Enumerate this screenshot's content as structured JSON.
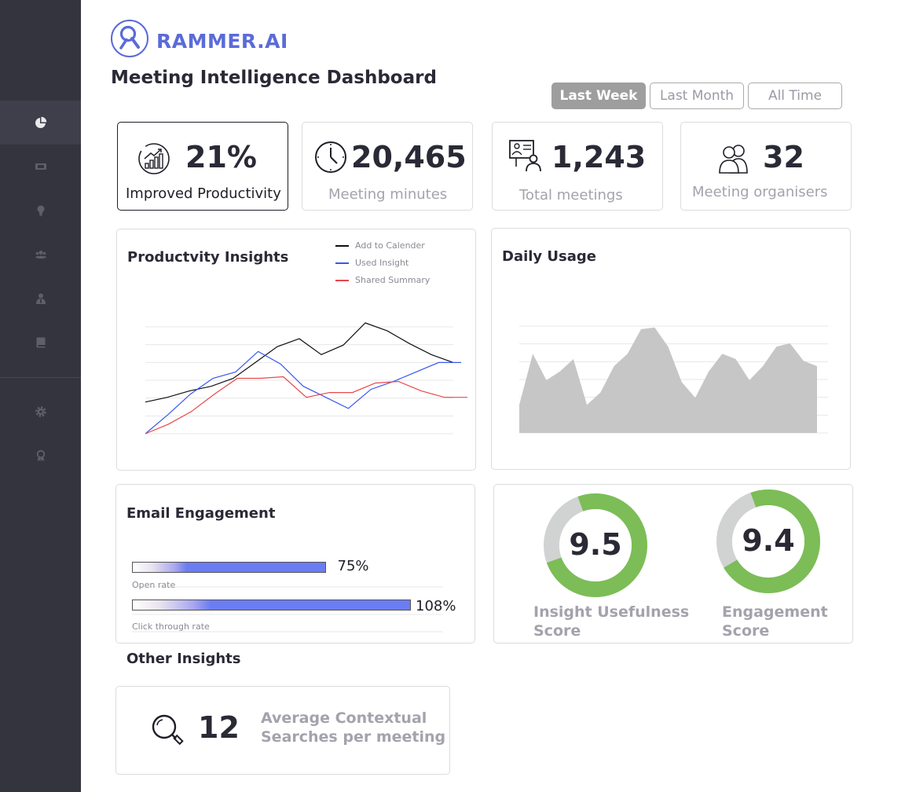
{
  "brand": {
    "name": "RAMMER.AI"
  },
  "page_title": "Meeting Intelligence Dashboard",
  "sidebar": {
    "items": [
      {
        "icon": "pie-chart-icon",
        "active": true
      },
      {
        "icon": "ticket-icon",
        "active": false
      },
      {
        "icon": "lightbulb-icon",
        "active": false
      },
      {
        "icon": "users-icon",
        "active": false
      },
      {
        "icon": "user-tie-icon",
        "active": false
      },
      {
        "icon": "book-icon",
        "active": false
      },
      {
        "icon": "gear-icon",
        "active": false
      },
      {
        "icon": "award-icon",
        "active": false
      }
    ]
  },
  "time_range": {
    "options": [
      "Last Week",
      "Last Month",
      "All Time"
    ],
    "selected": "Last Week"
  },
  "stats": [
    {
      "value": "21%",
      "label": "Improved Productivity",
      "icon": "growth-chart-icon",
      "selected": true
    },
    {
      "value": "20,465",
      "label": "Meeting minutes",
      "icon": "clock-icon",
      "selected": false
    },
    {
      "value": "1,243",
      "label": "Total meetings",
      "icon": "presentation-icon",
      "selected": false
    },
    {
      "value": "32",
      "label": "Meeting organisers",
      "icon": "people-icon",
      "selected": false
    }
  ],
  "productivity": {
    "title": "Productvity Insights",
    "legend": [
      "Add to Calender",
      "Used Insight",
      "Shared Summary"
    ]
  },
  "daily_usage": {
    "title": "Daily Usage"
  },
  "email": {
    "title": "Email Engagement",
    "bars": [
      {
        "label": "Open rate",
        "value_text": "75%",
        "value": 75
      },
      {
        "label": "Click through rate",
        "value_text": "108%",
        "value": 108
      }
    ]
  },
  "scores": [
    {
      "value_text": "9.5",
      "value": 9.5,
      "max": 10,
      "label_line1": "Insight Usefulness",
      "label_line2": "Score"
    },
    {
      "value_text": "9.4",
      "value": 9.4,
      "max": 10,
      "label_line1": "Engagement",
      "label_line2": "Score"
    }
  ],
  "other_insights": {
    "title": "Other Insights",
    "value": "12",
    "label_line1": "Average Contextual",
    "label_line2": "Searches per meeting",
    "icon": "search-icon"
  },
  "colors": {
    "accent": "#5b6bd8",
    "sidebar": "#34343f",
    "series_black": "#111111",
    "series_blue": "#3a57f0",
    "series_red": "#e8474b",
    "area_fill": "#c6c6c6",
    "donut_green": "#7cbd57",
    "donut_grey": "#d0d3d2"
  },
  "chart_data": [
    {
      "type": "line",
      "title": "Productvity Insights",
      "x": [
        1,
        2,
        3,
        4,
        5,
        6,
        7,
        8,
        9,
        10,
        11,
        12,
        13,
        14,
        15
      ],
      "series": [
        {
          "name": "Add to Calender",
          "values": [
            2,
            2.3,
            2.7,
            3,
            3.5,
            4.5,
            5.5,
            6,
            5,
            5.6,
            7,
            6.5,
            5.7,
            5,
            4.5
          ]
        },
        {
          "name": "Used Insight",
          "values": [
            0,
            1.2,
            2.5,
            3.5,
            3.9,
            5.2,
            4.4,
            3,
            2.3,
            1.6,
            2.8,
            3.3,
            3.9,
            4.5,
            4.5
          ]
        },
        {
          "name": "Shared Summary",
          "values": [
            0,
            0.6,
            1.4,
            2.5,
            3.5,
            3.5,
            3.6,
            2.3,
            2.6,
            2.6,
            3.2,
            3.3,
            2.7,
            2.3,
            2.3
          ]
        }
      ]
    },
    {
      "type": "area",
      "title": "Daily Usage",
      "x": [
        1,
        2,
        3,
        4,
        5,
        6,
        7,
        8,
        9,
        10,
        11,
        12,
        13,
        14,
        15,
        16,
        17,
        18,
        19,
        20,
        21,
        22,
        23
      ],
      "values": [
        1.6,
        4.5,
        3,
        3.5,
        4.2,
        1.6,
        2.3,
        3.8,
        4.5,
        5.9,
        6,
        4.9,
        2.9,
        2,
        3.5,
        4.5,
        4.2,
        3,
        3.8,
        4.9,
        5.1,
        4.1,
        3.8
      ]
    }
  ]
}
